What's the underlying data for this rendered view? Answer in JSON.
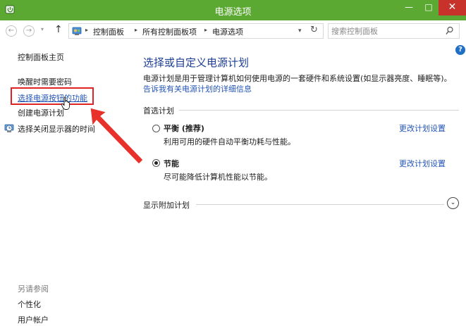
{
  "window": {
    "title": "电源选项",
    "minimize": "—",
    "maximize": "□",
    "close": "✕"
  },
  "address": {
    "nav_back": "←",
    "nav_forward": "→",
    "nav_dropdown": "▾",
    "nav_up": "↑",
    "breadcrumb": [
      "控制面板",
      "所有控制面板项",
      "电源选项"
    ],
    "separator": "▸",
    "dropdown": "▾",
    "refresh": "↻",
    "search_placeholder": "搜索控制面板"
  },
  "help": {
    "label": "?"
  },
  "sidebar": {
    "home": "控制面板主页",
    "links": [
      "唤醒时需要密码",
      "选择电源按钮的功能",
      "创建电源计划",
      "选择关闭显示器的时间"
    ],
    "see_also_title": "另请参阅",
    "see_also": [
      "个性化",
      "用户帐户"
    ]
  },
  "main": {
    "title": "选择或自定义电源计划",
    "description": "电源计划是用于管理计算机如何使用电源的一套硬件和系统设置(如显示器亮度、睡眠等)。",
    "description_link": "告诉我有关电源计划的详细信息",
    "preferred_label": "首选计划",
    "plans": [
      {
        "name": "平衡 (推荐)",
        "desc": "利用可用的硬件自动平衡功耗与性能。",
        "selected": false,
        "link": "更改计划设置"
      },
      {
        "name": "节能",
        "desc": "尽可能降低计算机性能以节能。",
        "selected": true,
        "link": "更改计划设置"
      }
    ],
    "more_plans_label": "显示附加计划",
    "expand": "⌄"
  },
  "colors": {
    "titlebar": "#5ba832",
    "link": "#2355b7",
    "heading": "#1e3e96",
    "highlight": "#e02222",
    "close_button": "#c7332a"
  }
}
